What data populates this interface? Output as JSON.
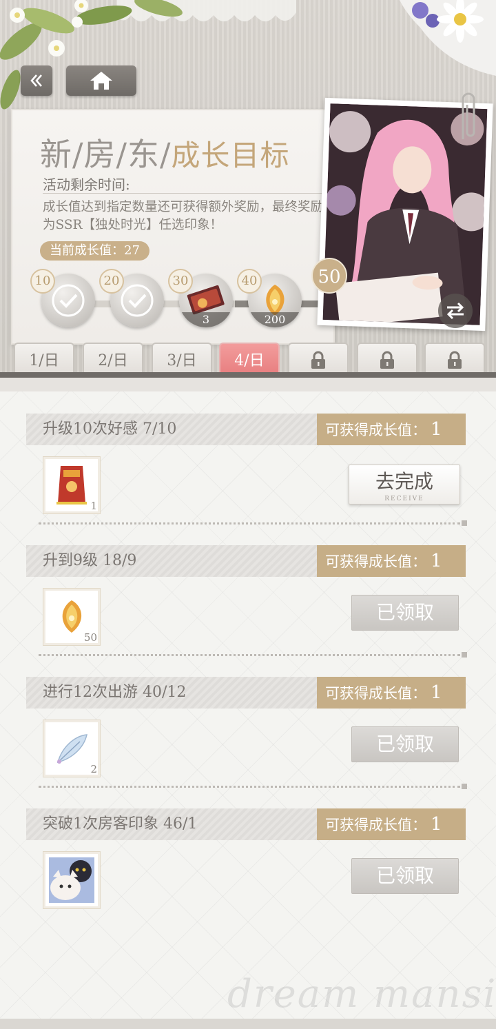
{
  "nav": {
    "back_icon": "double-chevron-left-icon",
    "home_icon": "home-icon"
  },
  "header": {
    "title_part1": "新/房/东/",
    "title_part2": "成长目标",
    "remaining_label": "活动剩余时间:",
    "description": "成长值达到指定数量还可获得额外奖励，最终奖励为SSR【独处时光】任选印象！",
    "current_growth": "当前成长值：27"
  },
  "milestones": [
    {
      "threshold": "10",
      "state": "claimed",
      "count": ""
    },
    {
      "threshold": "20",
      "state": "claimed",
      "count": ""
    },
    {
      "threshold": "30",
      "state": "reward",
      "count": "3"
    },
    {
      "threshold": "40",
      "state": "reward",
      "count": "200"
    }
  ],
  "final_goal": "50",
  "progress_fraction": 0.64,
  "tabs": [
    {
      "label": "1/日",
      "locked": false,
      "active": false
    },
    {
      "label": "2/日",
      "locked": false,
      "active": false
    },
    {
      "label": "3/日",
      "locked": false,
      "active": false
    },
    {
      "label": "4/日",
      "locked": false,
      "active": true
    },
    {
      "label": "",
      "locked": true,
      "active": false
    },
    {
      "label": "",
      "locked": true,
      "active": false
    },
    {
      "label": "",
      "locked": true,
      "active": false
    }
  ],
  "tasks": [
    {
      "title": "升级10次好感 7/10",
      "reward_label": "可获得成长值：",
      "reward_value": "1",
      "item_count": "1",
      "item_icon": "gift-bag-icon",
      "button": "去完成",
      "button_sub": "RECEIVE",
      "status": "go"
    },
    {
      "title": "升到9级 18/9",
      "reward_label": "可获得成长值：",
      "reward_value": "1",
      "item_count": "50",
      "item_icon": "amber-leaf-icon",
      "button": "已领取",
      "button_sub": "",
      "status": "done"
    },
    {
      "title": "进行12次出游 40/12",
      "reward_label": "可获得成长值：",
      "reward_value": "1",
      "item_count": "2",
      "item_icon": "feather-icon",
      "button": "已领取",
      "button_sub": "",
      "status": "done"
    },
    {
      "title": "突破1次房客印象 46/1",
      "reward_label": "可获得成长值：",
      "reward_value": "1",
      "item_count": "",
      "item_icon": "card-pack-icon",
      "button": "已领取",
      "button_sub": "",
      "status": "done"
    }
  ],
  "watermark": "dream mansion",
  "colors": {
    "gold": "#c6ae87",
    "active_tab": "#e77c7d",
    "claimed_button": "#c9c6c2"
  }
}
